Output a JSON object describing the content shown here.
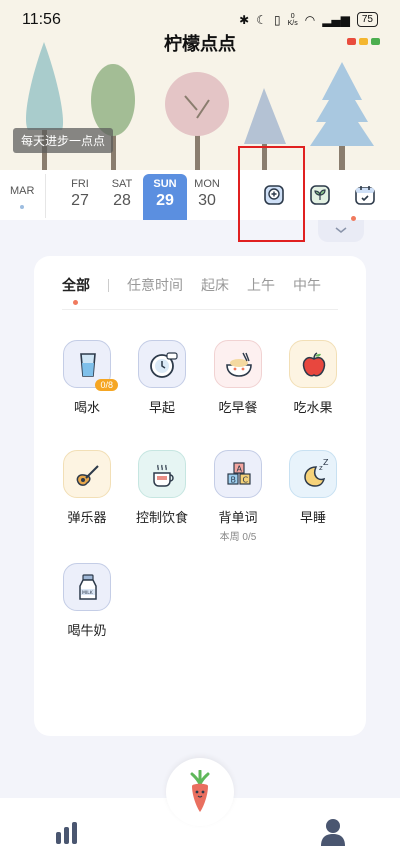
{
  "status": {
    "time": "11:56",
    "net_speed_value": "0",
    "net_speed_unit": "K/s",
    "battery": "75"
  },
  "app": {
    "title": "柠檬点点",
    "motto": "每天进步一点点"
  },
  "datebar": {
    "month": "MAR",
    "days": [
      {
        "name": "FRI",
        "date": "27"
      },
      {
        "name": "SAT",
        "date": "28"
      },
      {
        "name": "SUN",
        "date": "29",
        "selected": true
      },
      {
        "name": "MON",
        "date": "30"
      }
    ]
  },
  "tools": [
    "add-habit-icon",
    "plant-icon",
    "calendar-check-icon"
  ],
  "filters": {
    "tabs": [
      "全部",
      "任意时间",
      "起床",
      "上午",
      "中午"
    ],
    "active": "全部"
  },
  "habits": [
    {
      "label": "喝水",
      "icon": "water-glass-icon",
      "badge": "0/8"
    },
    {
      "label": "早起",
      "icon": "alarm-clock-icon"
    },
    {
      "label": "吃早餐",
      "icon": "bowl-icon"
    },
    {
      "label": "吃水果",
      "icon": "apple-icon"
    },
    {
      "label": "弹乐器",
      "icon": "guitar-icon"
    },
    {
      "label": "控制饮食",
      "icon": "coffee-cup-icon"
    },
    {
      "label": "背单词",
      "icon": "abc-blocks-icon",
      "sub": "本周 0/5"
    },
    {
      "label": "早睡",
      "icon": "moon-sleep-icon"
    },
    {
      "label": "喝牛奶",
      "icon": "milk-bottle-icon"
    }
  ],
  "colors": {
    "accent": "#5b8fe0",
    "header_bg": "#f7f3e8",
    "highlight_box": "#e02020"
  }
}
